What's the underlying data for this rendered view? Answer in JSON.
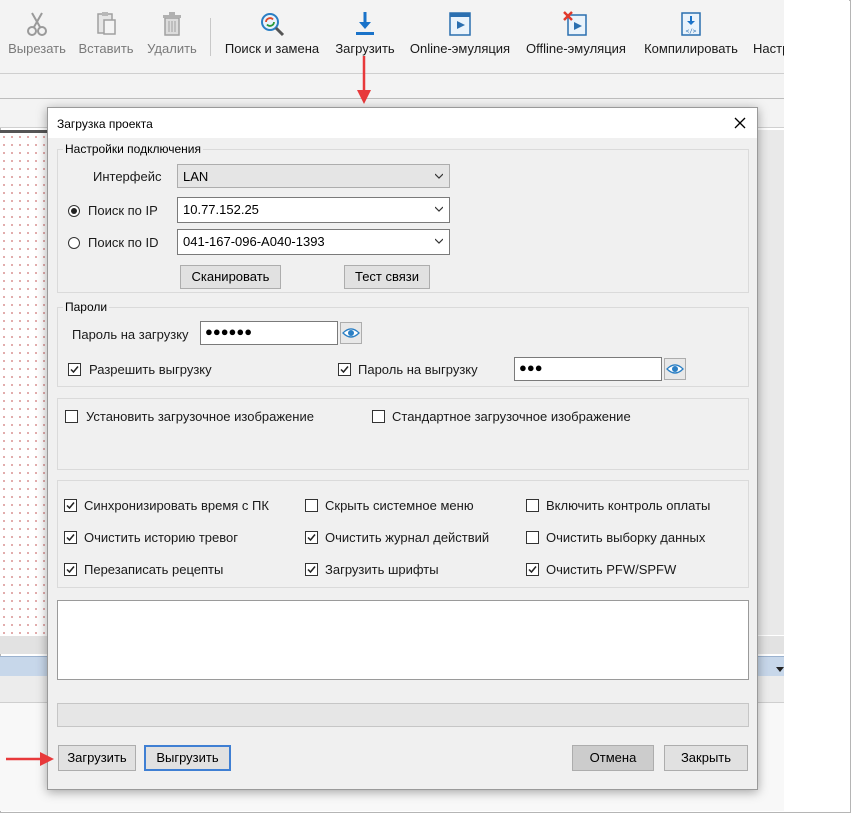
{
  "ribbon": {
    "items": [
      {
        "label": "Вырезать",
        "icon": "scissors-icon"
      },
      {
        "label": "Вставить",
        "icon": "paste-icon"
      },
      {
        "label": "Удалить",
        "icon": "trash-icon"
      },
      {
        "label": "Поиск и замена",
        "icon": "search-replace-icon"
      },
      {
        "label": "Загрузить",
        "icon": "download-icon"
      },
      {
        "label": "Online-эмуляция",
        "icon": "online-simulation-icon"
      },
      {
        "label": "Offline-эмуляция",
        "icon": "offline-simulation-icon"
      },
      {
        "label": "Компилировать",
        "icon": "compile-icon"
      },
      {
        "label": "Настр",
        "icon": ""
      }
    ]
  },
  "dialog": {
    "title": "Загрузка проекта",
    "connection": {
      "group_label": "Настройки подключения",
      "interface_label": "Интерфейс",
      "interface_value": "LAN",
      "ip_label": "Поиск по IP",
      "ip_value": "10.77.152.25",
      "ip_selected": true,
      "id_label": "Поиск по ID",
      "id_value": "041-167-096-A040-1393",
      "id_selected": false,
      "scan_button": "Сканировать",
      "test_button": "Тест связи"
    },
    "passwords": {
      "group_label": "Пароли",
      "upload_password_label": "Пароль на загрузку",
      "upload_password_value": "●●●●●●",
      "allow_export_label": "Разрешить выгрузку",
      "allow_export_checked": true,
      "export_password_label": "Пароль на выгрузку",
      "export_password_checked": true,
      "export_password_value": "●●●"
    },
    "boot_image": {
      "set_label": "Установить загрузочное изображение",
      "set_checked": false,
      "standard_label": "Стандартное загрузочное изображение",
      "standard_checked": false
    },
    "options": [
      {
        "label": "Синхронизировать время с ПК",
        "checked": true
      },
      {
        "label": "Скрыть системное меню",
        "checked": false
      },
      {
        "label": "Включить контроль оплаты",
        "checked": false
      },
      {
        "label": "Очистить историю тревог",
        "checked": true
      },
      {
        "label": "Очистить журнал действий",
        "checked": true
      },
      {
        "label": "Очистить выборку данных",
        "checked": false
      },
      {
        "label": "Перезаписать рецепты",
        "checked": true
      },
      {
        "label": "Загрузить шрифты",
        "checked": true
      },
      {
        "label": "Очистить PFW/SPFW",
        "checked": true
      }
    ],
    "log_text": "",
    "progress": 0,
    "buttons": {
      "download": "Загрузить",
      "upload": "Выгрузить",
      "cancel": "Отмена",
      "close": "Закрыть"
    }
  },
  "colors": {
    "annotation_arrow": "#e8393b",
    "focus_border": "#3f7fd3"
  }
}
